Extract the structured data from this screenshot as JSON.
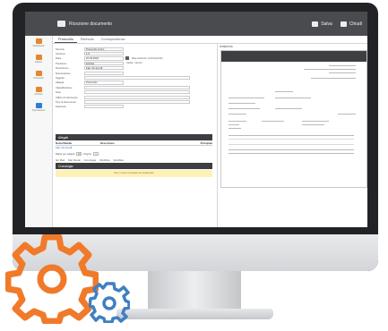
{
  "app": {
    "title": "Ricezione documento",
    "toolbar": {
      "btn1": "Salva",
      "btn2": "Chiudi"
    }
  },
  "sidebar": {
    "items": [
      {
        "label": "Dashboard",
        "icon": "home-icon",
        "color": "#e8862b"
      },
      {
        "label": "Fatture",
        "icon": "document-icon",
        "color": "#e8862b"
      },
      {
        "label": "Protocollo",
        "icon": "inbox-icon",
        "color": "#e8862b"
      },
      {
        "label": "Archivio",
        "icon": "archive-icon",
        "color": "#e8862b"
      },
      {
        "label": "Impostazioni",
        "icon": "plus-icon",
        "color": "#2c7fd0"
      }
    ]
  },
  "tabs": [
    "Protocollo",
    "Ricevuta",
    "Corrispondenza"
  ],
  "form": {
    "rows": [
      {
        "label": "Servizio",
        "value": "Protocollo Unico"
      },
      {
        "label": "Versione",
        "value": "1.0"
      },
      {
        "label": "Data",
        "value": "01.03.2022",
        "extra": "Data ricezione: 14.03 (GG/hh)"
      },
      {
        "label": "Posizione",
        "value": "Entrata",
        "extra": "Uscita · Interno"
      },
      {
        "label": "Descrizione",
        "value": "Fatt. 03-12.pdf"
      },
      {
        "label": "Numerazione",
        "value": ""
      },
      {
        "label": "Oggetto",
        "value": ""
      },
      {
        "label": "Allegati",
        "value": "Protocollo"
      },
      {
        "label": "Classificazione",
        "value": ""
      },
      {
        "label": "Note",
        "value": ""
      },
      {
        "label": "Ufficio di riferimento",
        "value": ""
      },
      {
        "label": "Tipo di documento",
        "value": ""
      },
      {
        "label": "Fascicolo",
        "value": ""
      }
    ]
  },
  "allegati": {
    "section_label": "Allegati",
    "columns": [
      "Nome/Tabella",
      "Descrizione",
      "Principale"
    ],
    "rows": [
      {
        "name": "Fatt. 03-12.pdf",
        "desc": "",
        "main": ""
      }
    ],
    "pager": {
      "label": "Righe per pagina",
      "value": "10",
      "pages_label": "Pagine",
      "page": "1"
    }
  },
  "lower_tabs": [
    "Iter Mail",
    "Dati Fiscali",
    "Cronologia",
    "Workflow",
    "Workflow"
  ],
  "history": {
    "label": "Cronologia",
    "notice": "Non ci sono cronologie da visualizzare"
  },
  "preview": {
    "label": "Anteprima"
  }
}
